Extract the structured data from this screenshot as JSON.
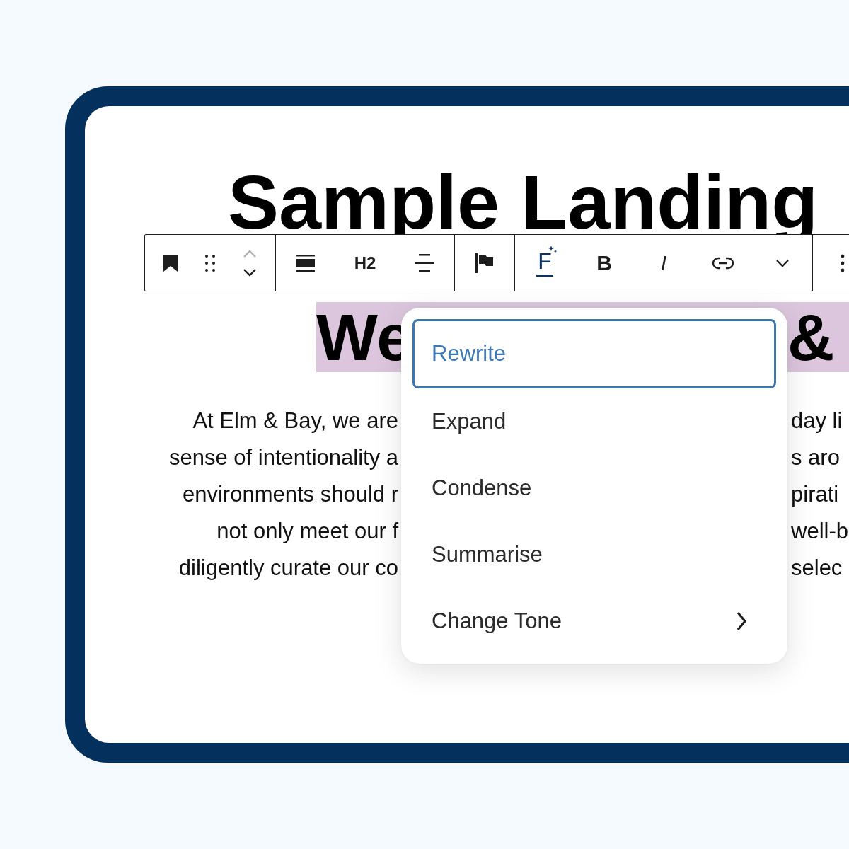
{
  "page_title": "Sample Landing",
  "toolbar": {
    "groups": [
      {
        "items": [
          {
            "kind": "bookmark"
          },
          {
            "kind": "drag"
          },
          {
            "kind": "mover"
          }
        ]
      },
      {
        "items": [
          {
            "kind": "align"
          },
          {
            "kind": "text",
            "label": "H2"
          },
          {
            "kind": "lines"
          }
        ]
      },
      {
        "items": [
          {
            "kind": "flag"
          }
        ]
      },
      {
        "items": [
          {
            "kind": "ai",
            "label": "F"
          },
          {
            "kind": "bold",
            "label": "B"
          },
          {
            "kind": "italic",
            "label": "I"
          },
          {
            "kind": "link"
          },
          {
            "kind": "chevron"
          }
        ]
      },
      {
        "items": [
          {
            "kind": "more"
          }
        ]
      }
    ]
  },
  "heading": {
    "left": "We",
    "right": "&"
  },
  "paragraph": [
    {
      "left": "At Elm & Bay, we are",
      "right": "day li"
    },
    {
      "left": "sense of intentionality a",
      "right": "s aro"
    },
    {
      "left": "environments should r",
      "right": "pirati"
    },
    {
      "left": "not only meet our f",
      "right": "well-b"
    },
    {
      "left": "diligently curate our co",
      "right": "selec"
    }
  ],
  "menu": {
    "items": [
      {
        "label": "Rewrite",
        "selected": true,
        "kind": "action"
      },
      {
        "label": "Expand",
        "selected": false,
        "kind": "action"
      },
      {
        "label": "Condense",
        "selected": false,
        "kind": "action"
      },
      {
        "label": "Summarise",
        "selected": false,
        "kind": "action"
      },
      {
        "label": "Change Tone",
        "selected": false,
        "kind": "submenu"
      }
    ]
  }
}
